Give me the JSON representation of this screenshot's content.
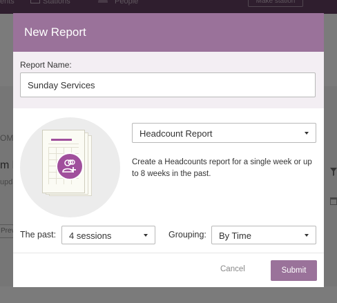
{
  "background": {
    "nav_tabs": [
      "ents",
      "Stations",
      "People"
    ],
    "make_station_label": "Make station",
    "fragment_om": "OM",
    "fragment_m": "m l",
    "fragment_upd": "upda",
    "fragment_prev": "Prev"
  },
  "modal": {
    "title": "New Report",
    "report_name_label": "Report Name:",
    "report_name_value": "Sunday Services",
    "report_type_value": "Headcount Report",
    "description": "Create a Headcounts report for a single week or up to 8 weeks in the past.",
    "past_label": "The past:",
    "past_value": "4 sessions",
    "grouping_label": "Grouping:",
    "grouping_value": "By Time",
    "cancel_label": "Cancel",
    "submit_label": "Submit"
  },
  "colors": {
    "brand": "#9a729a",
    "icon_accent": "#a04f9c",
    "nav_bg": "#5a3a58"
  },
  "icons": [
    "stations-icon",
    "people-icon",
    "report-document-icon",
    "add-people-icon",
    "dropdown-caret-icon",
    "filter-icon",
    "calendar-icon"
  ]
}
